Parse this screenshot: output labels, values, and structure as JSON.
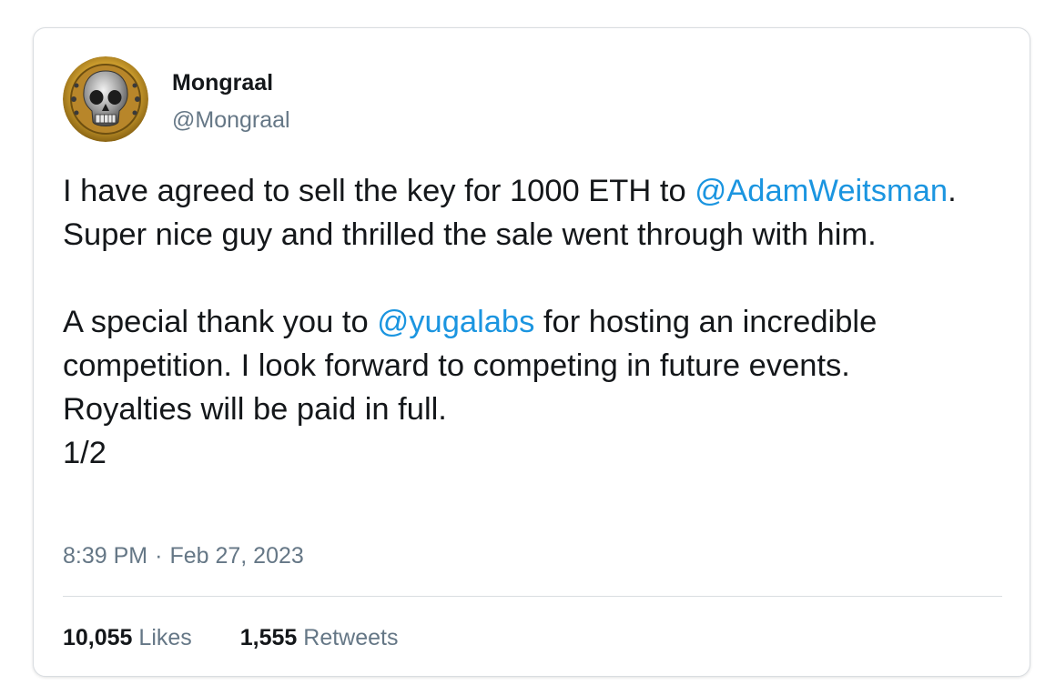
{
  "tweet": {
    "author": {
      "name": "Mongraal",
      "handle": "@Mongraal",
      "avatar_icon": "skull-coin-avatar"
    },
    "text": {
      "p1_part1": "I have agreed to sell the key for 1000 ETH to ",
      "p1_mention": "@AdamWeitsman",
      "p1_part2": ". Super nice guy and thrilled the sale went through with him.",
      "p2_part1": "A special thank you to ",
      "p2_mention": "@yugalabs",
      "p2_part2": " for hosting an incredible competition.  I look forward to competing in future events.",
      "p2_line3": "Royalties will be paid in full.",
      "p2_line4": "1/2"
    },
    "time": "8:39 PM",
    "separator": "·",
    "date": "Feb 27, 2023",
    "likes_count": "10,055",
    "likes_label": "Likes",
    "retweets_count": "1,555",
    "retweets_label": "Retweets"
  },
  "colors": {
    "text": "#14171a",
    "secondary": "#657786",
    "link": "#1b95e0",
    "border": "#d9dde1"
  }
}
